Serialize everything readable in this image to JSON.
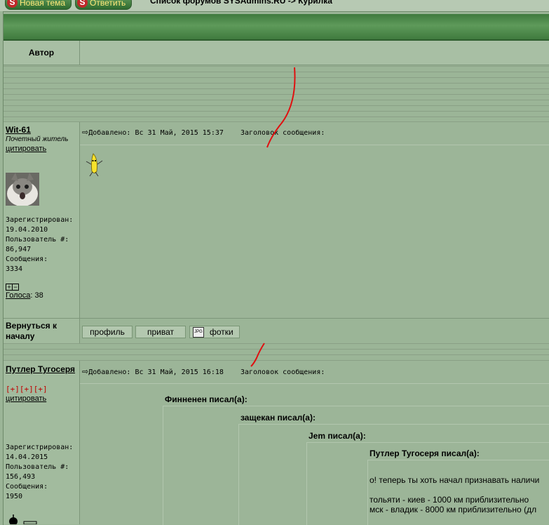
{
  "topbar": {
    "new_topic": "Новая тема",
    "reply": "Ответить",
    "breadcrumb": "Список форумов SYSAdmins.RU -> Курилка"
  },
  "table": {
    "author_header": "Автор"
  },
  "posts": [
    {
      "username": "Wit-61",
      "rank": "Почетный житель",
      "quote_link": "цитировать",
      "registered_label": "Зарегистрирован:",
      "registered": "19.04.2010",
      "user_no_label": "Пользователь #:",
      "user_no": "86,947",
      "messages_label": "Сообщения:",
      "messages": "3334",
      "votes_label": "Голоса",
      "votes": ": 38",
      "meta": "Добавлено: Вс 31 Май, 2015 15:37    Заголовок сообщения:",
      "back_to_top": "Вернуться к началу",
      "buttons": [
        "профиль",
        "приват",
        "фотки"
      ]
    },
    {
      "username": "Путлер Тугосеря",
      "rank_stars": "[+][+][+]",
      "quote_link": "цитировать",
      "registered_label": "Зарегистрирован:",
      "registered": "14.04.2015",
      "user_no_label": "Пользователь #:",
      "user_no": "156,493",
      "messages_label": "Сообщения:",
      "messages": "1950",
      "meta": "Добавлено: Вс 31 Май, 2015 16:18    Заголовок сообщения:",
      "quotes": [
        "Финненен писал(а):",
        "защекан писал(а):",
        "Jem писал(а):",
        "Путлер Тугосеря писал(а):"
      ],
      "body_lines": [
        "о! теперь ты хоть начал признавать наличи",
        "тольяти - киев - 1000 км приблизительно",
        "мск - владик - 8000 км приблизительно (дл"
      ]
    }
  ]
}
